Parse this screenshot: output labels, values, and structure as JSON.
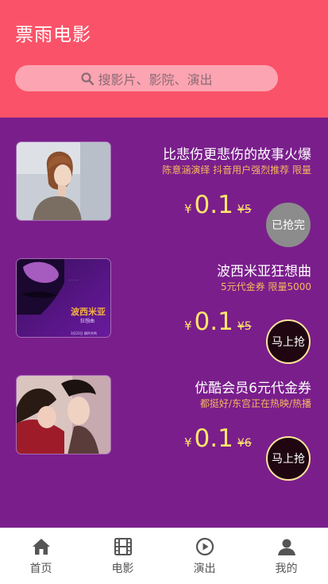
{
  "header": {
    "title": "票雨电影",
    "search_placeholder": "搜影片、影院、演出",
    "search_icon": "search-icon"
  },
  "colors": {
    "header_bg": "#fa5369",
    "main_bg": "#7a1e8c",
    "price": "#ffe66b",
    "desc": "#f6b85f"
  },
  "deals": [
    {
      "title": "比悲伤更悲伤的故事火爆",
      "desc": "陈意涵演绎 抖音用户强烈推荐 限量",
      "currency": "¥",
      "price": "0.1",
      "old_price": "¥5",
      "button": "已抢完",
      "button_state": "sold-out"
    },
    {
      "title": "波西米亚狂想曲",
      "desc": "5元代金券 限量5000",
      "currency": "¥",
      "price": "0.1",
      "old_price": "¥5",
      "button": "马上抢",
      "button_state": "available",
      "poster_text": "波西米亚",
      "poster_sub": "狂想曲",
      "poster_date": "3月22日 情怀共鸣"
    },
    {
      "title": "优酷会员6元代金券",
      "desc": "都挺好/东宫正在热映/热播",
      "currency": "¥",
      "price": "0.1",
      "old_price": "¥6",
      "button": "马上抢",
      "button_state": "available"
    }
  ],
  "tabs": [
    {
      "label": "首页",
      "icon": "home-icon"
    },
    {
      "label": "电影",
      "icon": "film-icon"
    },
    {
      "label": "演出",
      "icon": "play-icon"
    },
    {
      "label": "我的",
      "icon": "user-icon"
    }
  ]
}
